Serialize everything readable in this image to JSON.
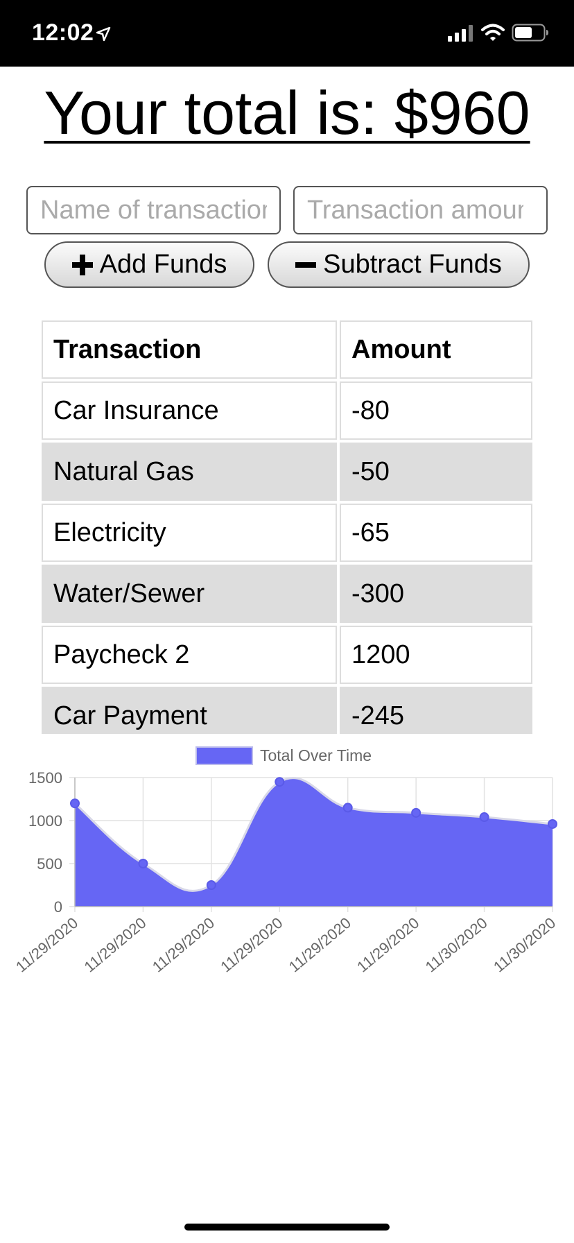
{
  "status": {
    "time": "12:02"
  },
  "header": {
    "total_text": "Your total is: $960"
  },
  "form": {
    "name_placeholder": "Name of transaction",
    "amount_placeholder": "Transaction amount",
    "add_label": "Add Funds",
    "subtract_label": "Subtract Funds"
  },
  "table": {
    "headers": [
      "Transaction",
      "Amount"
    ],
    "rows": [
      {
        "name": "Car Insurance",
        "amount": "-80"
      },
      {
        "name": "Natural Gas",
        "amount": "-50"
      },
      {
        "name": "Electricity",
        "amount": "-65"
      },
      {
        "name": "Water/Sewer",
        "amount": "-300"
      },
      {
        "name": "Paycheck 2",
        "amount": "1200"
      },
      {
        "name": "Car Payment",
        "amount": "-245"
      }
    ]
  },
  "colors": {
    "chart_fill": "#6666f4",
    "chart_line": "#d8d8e8",
    "row_shade": "#dddddd"
  },
  "chart_data": {
    "type": "area",
    "x": [
      "11/29/2020",
      "11/29/2020",
      "11/29/2020",
      "11/29/2020",
      "11/29/2020",
      "11/29/2020",
      "11/30/2020",
      "11/30/2020"
    ],
    "series": [
      {
        "name": "Total Over Time",
        "values": [
          1200,
          500,
          250,
          1450,
          1150,
          1090,
          1040,
          960
        ]
      }
    ],
    "ylim": [
      0,
      1500
    ],
    "yticks": [
      1500,
      1000,
      500,
      0
    ],
    "grid": true,
    "legend": "top-center"
  }
}
